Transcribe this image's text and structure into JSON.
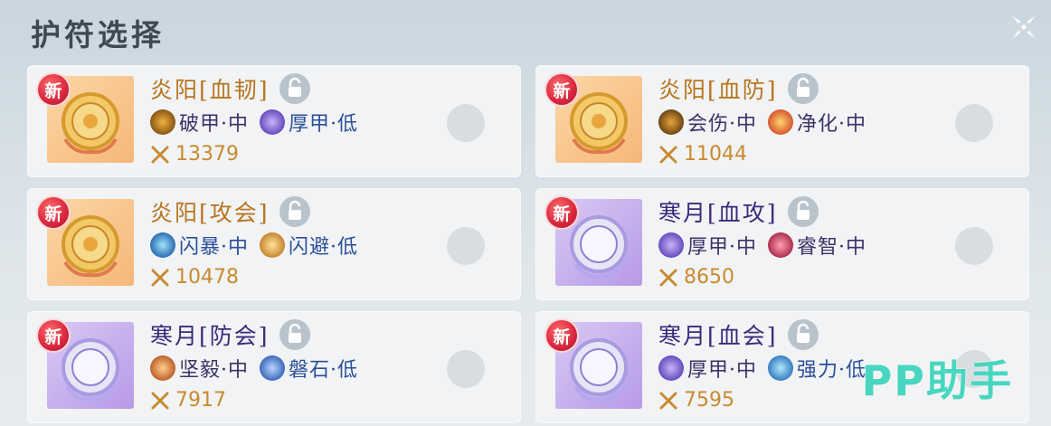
{
  "header": {
    "title": "护符选择"
  },
  "badge_label": "新",
  "charms": [
    {
      "name": "炎阳[血韧]",
      "theme": "sun",
      "props": [
        {
          "icon": "armor-break-icon",
          "label": "破甲·中"
        },
        {
          "icon": "thick-armor-icon",
          "label": "厚甲·低"
        }
      ],
      "power": "13379"
    },
    {
      "name": "炎阳[血防]",
      "theme": "sun",
      "props": [
        {
          "icon": "crit-damage-icon",
          "label": "会伤·中"
        },
        {
          "icon": "purify-icon",
          "label": "净化·中"
        }
      ],
      "power": "11044"
    },
    {
      "name": "炎阳[攻会]",
      "theme": "sun",
      "props": [
        {
          "icon": "flash-burst-icon",
          "label": "闪暴·中"
        },
        {
          "icon": "flash-dodge-icon",
          "label": "闪避·低"
        }
      ],
      "power": "10478"
    },
    {
      "name": "寒月[血攻]",
      "theme": "moon",
      "props": [
        {
          "icon": "thick-armor-icon",
          "label": "厚甲·中"
        },
        {
          "icon": "wisdom-icon",
          "label": "睿智·中"
        }
      ],
      "power": "8650"
    },
    {
      "name": "寒月[防会]",
      "theme": "moon",
      "props": [
        {
          "icon": "resolute-icon",
          "label": "坚毅·中"
        },
        {
          "icon": "boulder-icon",
          "label": "磐石·低"
        }
      ],
      "power": "7917"
    },
    {
      "name": "寒月[血会]",
      "theme": "moon",
      "props": [
        {
          "icon": "thick-armor-icon",
          "label": "厚甲·中"
        },
        {
          "icon": "strength-icon",
          "label": "强力·低"
        }
      ],
      "power": "7595"
    }
  ],
  "watermark": "PP助手",
  "colors": {
    "sun_name": "#b8751f",
    "moon_name": "#3d2a7a",
    "power": "#c98a2e",
    "new_badge": "#d7263d"
  }
}
